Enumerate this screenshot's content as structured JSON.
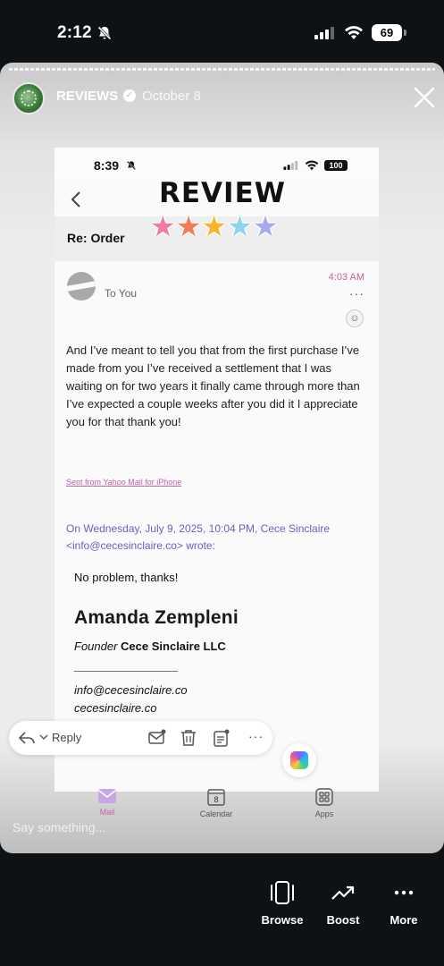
{
  "os_status": {
    "time": "2:12",
    "battery": "69"
  },
  "story": {
    "username": "REVIEWS",
    "verified_mark": "✓",
    "date": "October 8",
    "input_placeholder": "Say something..."
  },
  "inner_screenshot": {
    "status": {
      "time": "8:39",
      "battery": "100"
    },
    "subject": "Re: Order",
    "sticker": {
      "text": "REVIEW",
      "stars": 5,
      "star_colors": [
        "#f07aa0",
        "#f47a58",
        "#f6b52c",
        "#8fd3ec",
        "#a8a9ea"
      ]
    },
    "message": {
      "recipient": "To You",
      "time": "4:03 AM",
      "body": "And I’ve meant to tell you that from the first purchase I’ve made from you I’ve received a settlement that I was waiting on for two years it finally came through more than I’ve expected a couple weeks after you did it I appreciate you for that thank you!",
      "sent_from": "Sent from Yahoo Mail for iPhone",
      "quote_header": "On Wednesday, July 9, 2025, 10:04 PM, Cece Sinclaire <info@cecesinclaire.co> wrote:",
      "quote_line": "No problem, thanks!",
      "signature": {
        "name": "Amanda Zempleni",
        "role": "Founder",
        "company": "Cece Sinclaire LLC",
        "email": "info@cecesinclaire.co",
        "website": "cecesinclaire.co"
      }
    },
    "toolbar": {
      "reply_label": "Reply"
    },
    "tabs": [
      {
        "label": "Mail",
        "active": true
      },
      {
        "label": "Calendar",
        "icon_text": "8"
      },
      {
        "label": "Apps"
      }
    ],
    "accent_color": "#c064a8",
    "link_color": "#6b5fc7"
  },
  "actions": [
    {
      "label": "Browse",
      "icon": "browse-icon"
    },
    {
      "label": "Boost",
      "icon": "trending-up-icon"
    },
    {
      "label": "More",
      "icon": "more-dots-icon"
    }
  ]
}
